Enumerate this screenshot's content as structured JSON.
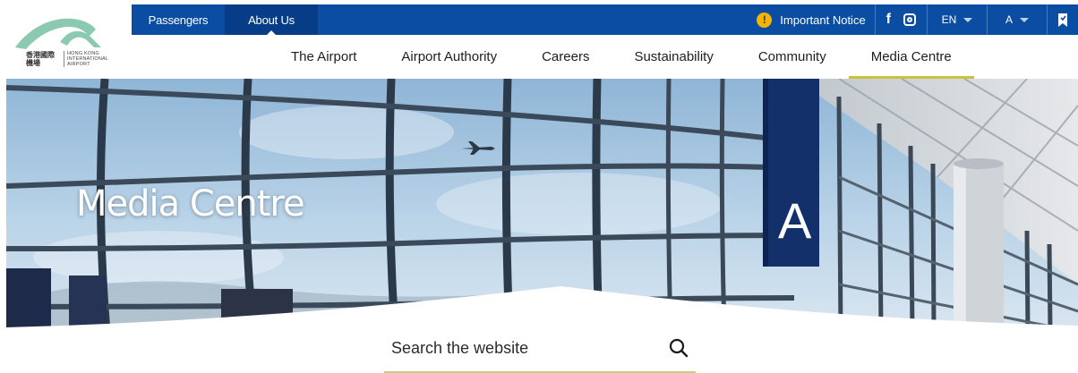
{
  "topbar": {
    "tabs": [
      "Passengers",
      "About Us"
    ],
    "notice_label": "Important Notice",
    "language": "EN",
    "font_size": "A"
  },
  "logo": {
    "chinese_text": "香港國際機場",
    "english_text": "HONG KONG INTERNATIONAL AIRPORT"
  },
  "nav": {
    "items": [
      "The Airport",
      "Airport Authority",
      "Careers",
      "Sustainability",
      "Community",
      "Media Centre"
    ],
    "active": "Media Centre"
  },
  "hero": {
    "title": "Media Centre",
    "sign_letter": "A"
  },
  "search": {
    "placeholder": "Search the website"
  },
  "colors": {
    "brand_blue": "#0a4da2",
    "active_tab_blue": "#063d86",
    "accent_underline": "#c9c23b",
    "notice_yellow": "#f5b400",
    "logo_green": "#8bc9b0"
  },
  "icons": {
    "notice": "exclamation-circle-icon",
    "facebook": "facebook-icon",
    "instagram": "instagram-icon",
    "bookmark": "bookmark-icon",
    "search": "search-icon"
  }
}
